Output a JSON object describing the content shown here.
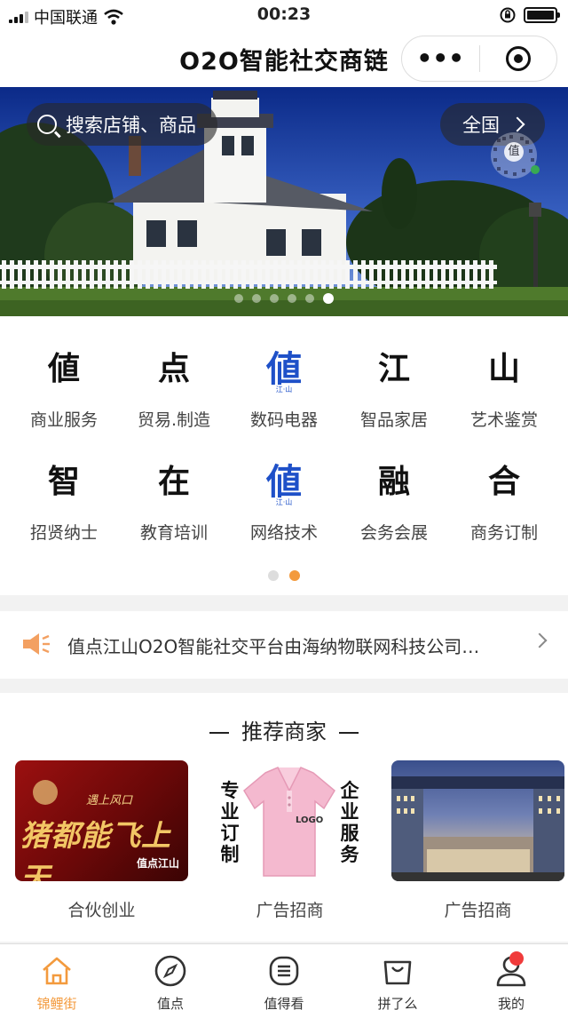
{
  "status_bar": {
    "carrier": "中国联通",
    "time": "00:23"
  },
  "nav": {
    "title": "O2O智能社交商链",
    "more_icon": "more-dots-icon",
    "close_icon": "target-circle-icon"
  },
  "banner": {
    "search_placeholder": "搜索店铺、商品",
    "region_label": "全国",
    "qr_char": "值",
    "slide_count": 6,
    "active_slide": 6
  },
  "categories": {
    "items": [
      {
        "glyph": "値",
        "label": "商业服务",
        "logo": false
      },
      {
        "glyph": "点",
        "label": "贸易.制造",
        "logo": false
      },
      {
        "glyph": "値",
        "label": "数码电器",
        "logo": true,
        "sub": "江·山"
      },
      {
        "glyph": "江",
        "label": "智品家居",
        "logo": false
      },
      {
        "glyph": "山",
        "label": "艺术鉴赏",
        "logo": false
      },
      {
        "glyph": "智",
        "label": "招贤纳士",
        "logo": false
      },
      {
        "glyph": "在",
        "label": "教育培训",
        "logo": false
      },
      {
        "glyph": "値",
        "label": "网络技术",
        "logo": true,
        "sub": "江·山"
      },
      {
        "glyph": "融",
        "label": "会务会展",
        "logo": false
      },
      {
        "glyph": "合",
        "label": "商务订制",
        "logo": false
      }
    ],
    "page_count": 2,
    "active_page": 2
  },
  "notice": {
    "text": "值点江山O2O智能社交平台由海纳物联网科技公司…"
  },
  "recommended": {
    "title": "推荐商家",
    "cards": [
      {
        "label": "合伙创业",
        "ad_top": "遇上风口",
        "ad_text": "猪都能飞上天",
        "ad_brand": "值点江山"
      },
      {
        "label": "广告招商",
        "ad_left": "专业订制",
        "ad_right": "企业服务",
        "ad_shirt": "LOGO"
      },
      {
        "label": "广告招商"
      }
    ]
  },
  "tabbar": {
    "items": [
      {
        "label": "锦鲤街",
        "icon": "home-icon",
        "active": true
      },
      {
        "label": "值点",
        "icon": "compass-icon",
        "active": false
      },
      {
        "label": "值得看",
        "icon": "list-icon",
        "active": false
      },
      {
        "label": "拼了么",
        "icon": "shopping-bag-icon",
        "active": false
      },
      {
        "label": "我的",
        "icon": "user-icon",
        "active": false,
        "badge": true
      }
    ],
    "accent_color": "#f39a3d"
  }
}
